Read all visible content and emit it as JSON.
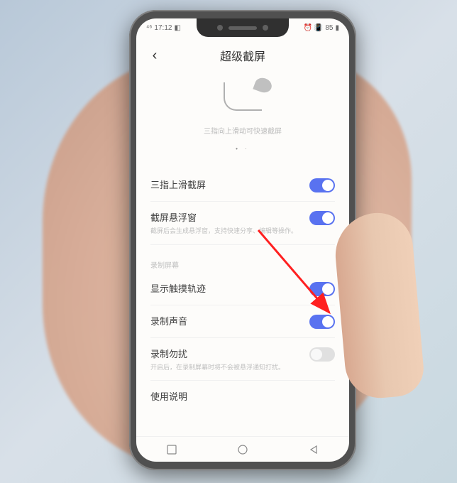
{
  "status_bar": {
    "time": "17:12",
    "battery": "85"
  },
  "header": {
    "title": "超级截屏",
    "back_icon": "‹"
  },
  "illustration": {
    "caption": "三指向上滑动可快速截屏",
    "dots": "• ·"
  },
  "rows": {
    "three_finger": {
      "label": "三指上滑截屏"
    },
    "float_window": {
      "label": "截屏悬浮窗",
      "desc": "截屏后会生成悬浮窗，支持快速分享、编辑等操作。"
    },
    "section": "录制屏幕",
    "touch_track": {
      "label": "显示触摸轨迹"
    },
    "record_sound": {
      "label": "录制声音"
    },
    "dnd": {
      "label": "录制勿扰",
      "desc": "开启后，在录制屏幕时将不会被悬浮通知打扰。"
    },
    "instructions": {
      "label": "使用说明"
    }
  },
  "colors": {
    "accent": "#5972f0"
  }
}
